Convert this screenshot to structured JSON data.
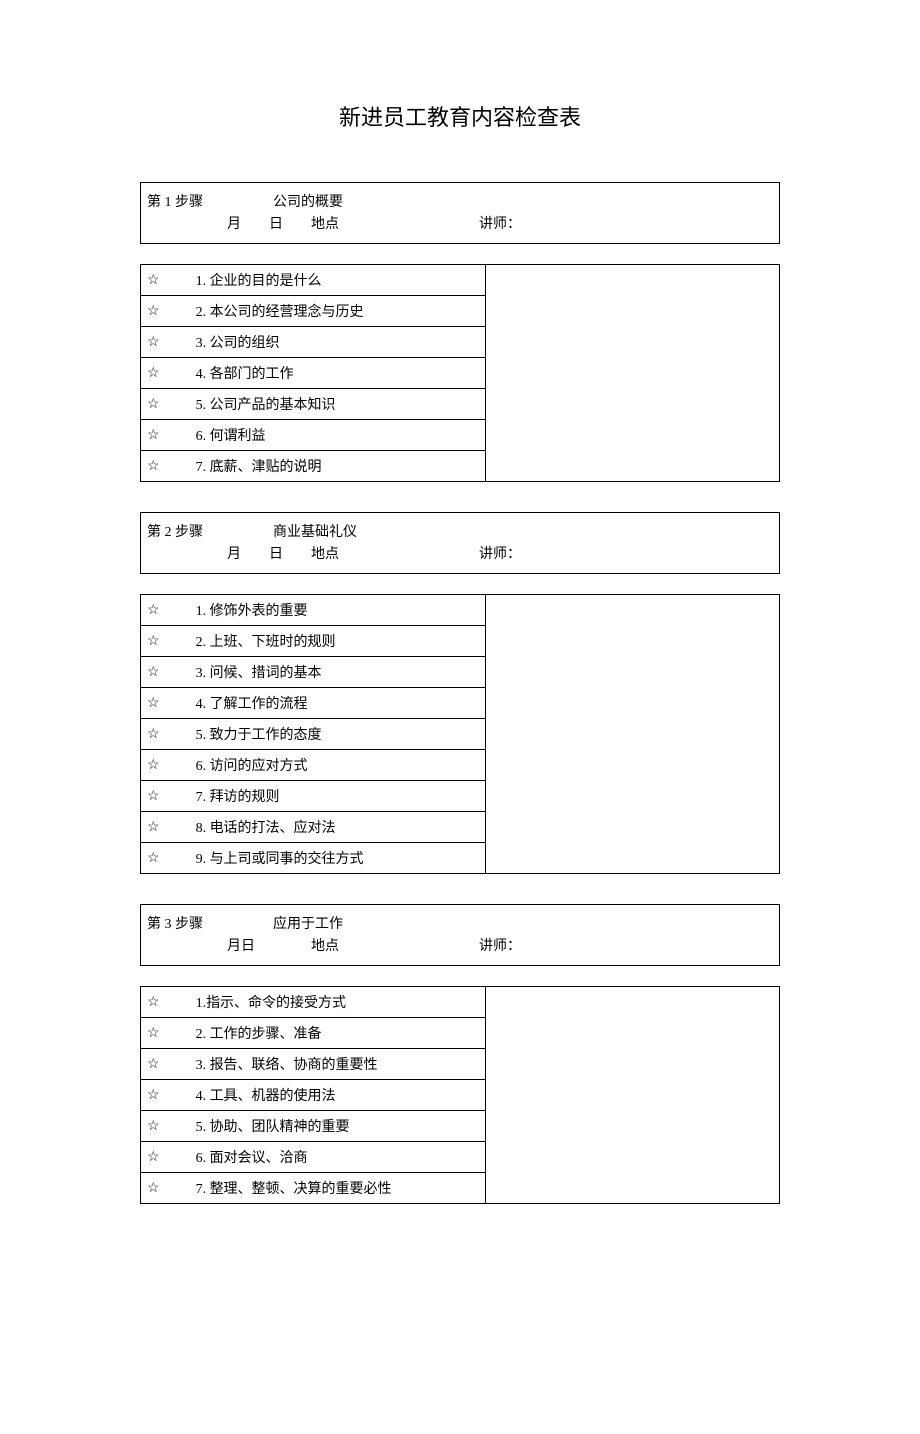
{
  "title": "新进员工教育内容检查表",
  "star": "☆",
  "steps": [
    {
      "label": "第 1 步骤",
      "topic": "公司的概要",
      "month": "月",
      "day": "日",
      "location": "地点",
      "lecturer_label": "讲师：",
      "items": [
        "1. 企业的目的是什么",
        "2. 本公司的经营理念与历史",
        "3. 公司的组织",
        "4. 各部门的工作",
        "5. 公司产品的基本知识",
        "6. 何谓利益",
        "7. 底薪、津贴的说明"
      ]
    },
    {
      "label": "第 2 步骤",
      "topic": "商业基础礼仪",
      "month": "月",
      "day": "日",
      "location": "地点",
      "lecturer_label": "讲师：",
      "items": [
        "1. 修饰外表的重要",
        "2. 上班、下班时的规则",
        "3. 问候、措词的基本",
        "4. 了解工作的流程",
        "5. 致力于工作的态度",
        "6. 访问的应对方式",
        "7. 拜访的规则",
        "8. 电话的打法、应对法",
        "9. 与上司或同事的交往方式"
      ]
    },
    {
      "label": "第 3 步骤",
      "topic": "应用于工作",
      "month_day": "月日",
      "location": "地点",
      "lecturer_label": "讲师：",
      "items": [
        "1.指示、命令的接受方式",
        "2. 工作的步骤、准备",
        "3. 报告、联络、协商的重要性",
        "4. 工具、机器的使用法",
        "5. 协助、团队精神的重要",
        "6. 面对会议、洽商",
        "7. 整理、整顿、决算的重要必性"
      ]
    }
  ]
}
